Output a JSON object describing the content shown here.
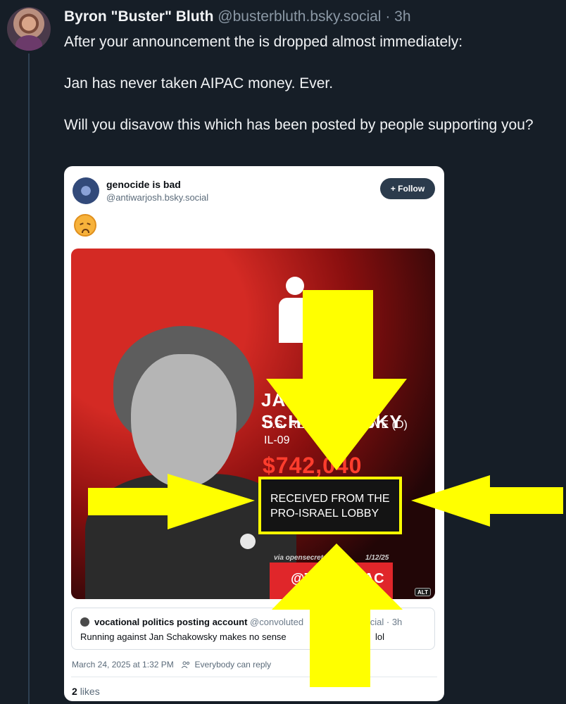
{
  "post": {
    "author_name": "Byron \"Buster\" Bluth",
    "handle": "@busterbluth.bsky.social",
    "separator": "·",
    "time": "3h",
    "paragraphs": [
      "After your announcement the is dropped almost immediately:",
      "Jan has never taken AIPAC money. Ever.",
      "Will you disavow this which has been posted by people supporting you?"
    ]
  },
  "embed": {
    "author_name": "genocide is bad",
    "handle": "@antiwarjosh.bsky.social",
    "follow_label": "+ Follow",
    "emoji_name": "disappointed-face-emoji",
    "image": {
      "rep_name": "JAN SCHAKOWSKY",
      "rep_title_line1": "U.S. REPRESENTATIVE (D)",
      "rep_title_line2": "IL-09",
      "amount": "$742,040",
      "received_line1": "RECEIVED FROM THE",
      "received_line2": "PRO-ISRAEL LOBBY",
      "via": "via opensecrets.org",
      "date": "1/12/25",
      "handle_banner": "@TrackAIPAC",
      "alt_badge": "ALT",
      "highlight_color": "#ffff00"
    },
    "quote": {
      "author_name": "vocational politics posting account",
      "handle": "@convoluted",
      "handle_tail": "social",
      "time": "3h",
      "text": "Running against Jan Schakowsky makes no sense",
      "text_tail": "lol"
    },
    "timestamp": "March 24, 2025 at 1:32 PM",
    "reply_setting": "Everybody can reply",
    "likes_count": "2",
    "likes_label": "likes"
  },
  "colors": {
    "background": "#161e27",
    "text": "#f1f3f5",
    "muted": "#8b98a5",
    "arrow": "#ffff00"
  }
}
